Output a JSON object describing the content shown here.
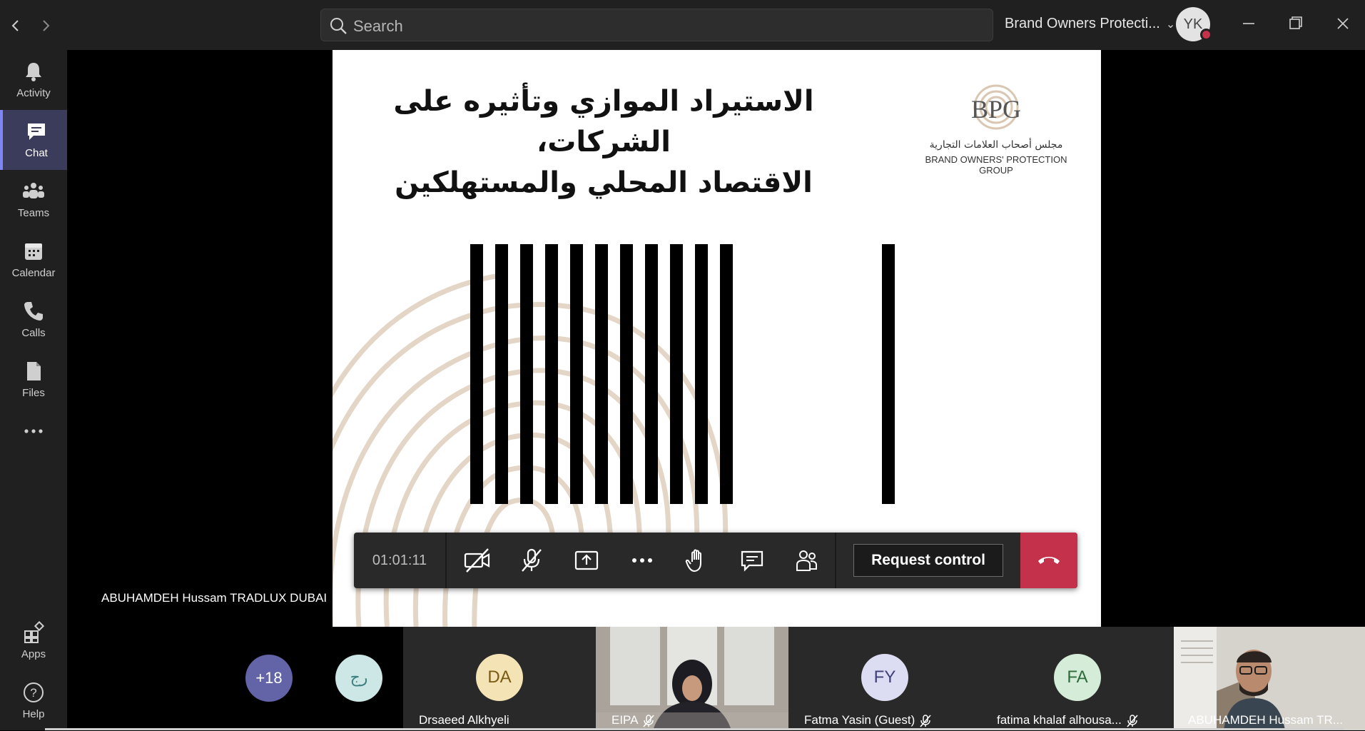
{
  "titlebar": {
    "search_placeholder": "Search",
    "org_name": "Brand Owners Protecti...",
    "user_initials": "YK",
    "status_color": "#c4314b"
  },
  "rail": {
    "items": [
      {
        "label": "Activity",
        "icon": "bell-icon"
      },
      {
        "label": "Chat",
        "icon": "chat-icon",
        "active": true
      },
      {
        "label": "Teams",
        "icon": "teams-icon"
      },
      {
        "label": "Calendar",
        "icon": "calendar-icon"
      },
      {
        "label": "Calls",
        "icon": "phone-icon"
      },
      {
        "label": "Files",
        "icon": "file-icon"
      },
      {
        "label": "",
        "icon": "more-icon"
      },
      {
        "label": "Apps",
        "icon": "apps-icon"
      },
      {
        "label": "Help",
        "icon": "help-icon"
      }
    ],
    "accent_color": "#7f85f5"
  },
  "slide": {
    "title_line1": "الاستيراد الموازي وتأثيره على الشركات،",
    "title_line2": "الاقتصاد المحلي والمستهلكين",
    "logo_text": "BPG",
    "logo_arabic": "مجلس أصحاب العلامات التجارية",
    "logo_english": "BRAND OWNERS' PROTECTION GROUP"
  },
  "presenter_name": "ABUHAMDEH Hussam TRADLUX DUBAI",
  "call_controls": {
    "timer": "01:01:11",
    "request_control_label": "Request control"
  },
  "participants": {
    "overflow_count": "+18",
    "tiles": [
      {
        "initials": "رج",
        "name": "",
        "color": "#cde6e6",
        "text_color": "#3b7c7c"
      },
      {
        "initials": "DA",
        "name": "Drsaeed Alkhyeli",
        "color": "#f4e3b4",
        "text_color": "#7a5a12"
      },
      {
        "initials": "",
        "name": "EIPA",
        "video": true
      },
      {
        "initials": "FY",
        "name": "Fatma Yasin (Guest)",
        "color": "#dcdcf2",
        "text_color": "#3f3f7a"
      },
      {
        "initials": "FA",
        "name": "fatima khalaf alhousa...",
        "color": "#d5ecd9",
        "text_color": "#2e6b3a"
      },
      {
        "initials": "",
        "name": "ABUHAMDEH Hussam TR...",
        "video": true
      }
    ]
  }
}
